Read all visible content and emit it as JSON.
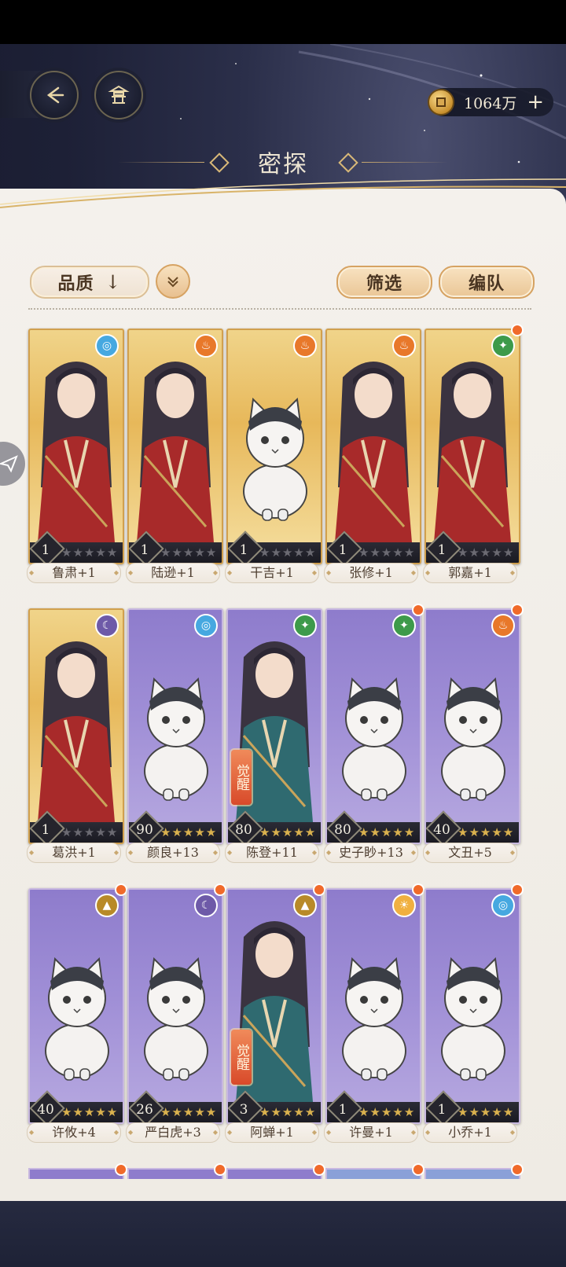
{
  "header": {
    "currency_amount": "1064万",
    "title": "密探"
  },
  "toolbar": {
    "sort_label": "品质",
    "sort_arrow": "↓",
    "filter_label": "筛选",
    "team_label": "编队"
  },
  "colors": {
    "accent_gold": "#d6a262",
    "card_gold": "#e7b85a",
    "card_purple": "#9f8ed6",
    "notify_dot": "#f06a2a"
  },
  "cards": [
    {
      "name": "鲁肃+1",
      "level": "1",
      "quality": "gold",
      "element": "water-icon",
      "stars_lit": 0,
      "red_dot": false,
      "awakened": false,
      "is_cat": false
    },
    {
      "name": "陆逊+1",
      "level": "1",
      "quality": "gold",
      "element": "fire-icon",
      "stars_lit": 0,
      "red_dot": false,
      "awakened": false,
      "is_cat": false
    },
    {
      "name": "干吉+1",
      "level": "1",
      "quality": "gold",
      "element": "fire-icon",
      "stars_lit": 0,
      "red_dot": false,
      "awakened": false,
      "is_cat": true
    },
    {
      "name": "张修+1",
      "level": "1",
      "quality": "gold",
      "element": "fire-icon",
      "stars_lit": 0,
      "red_dot": false,
      "awakened": false,
      "is_cat": false
    },
    {
      "name": "郭嘉+1",
      "level": "1",
      "quality": "gold",
      "element": "wood-icon",
      "stars_lit": 0,
      "red_dot": true,
      "awakened": false,
      "is_cat": false
    },
    {
      "name": "葛洪+1",
      "level": "1",
      "quality": "gold",
      "element": "moon-icon",
      "stars_lit": 0,
      "red_dot": false,
      "awakened": false,
      "is_cat": false
    },
    {
      "name": "颜良+13",
      "level": "90",
      "quality": "purple",
      "element": "water-icon",
      "stars_lit": 5,
      "red_dot": false,
      "awakened": false,
      "is_cat": true
    },
    {
      "name": "陈登+11",
      "level": "80",
      "quality": "purple",
      "element": "wood-icon",
      "stars_lit": 5,
      "red_dot": false,
      "awakened": true,
      "is_cat": false
    },
    {
      "name": "史子眇+13",
      "level": "80",
      "quality": "purple",
      "element": "wood-icon",
      "stars_lit": 5,
      "red_dot": true,
      "awakened": false,
      "is_cat": true
    },
    {
      "name": "文丑+5",
      "level": "40",
      "quality": "purple",
      "element": "fire-icon",
      "stars_lit": 5,
      "red_dot": true,
      "awakened": false,
      "is_cat": true
    },
    {
      "name": "许攸+4",
      "level": "40",
      "quality": "purple",
      "element": "earth-icon",
      "stars_lit": 5,
      "red_dot": true,
      "awakened": false,
      "is_cat": true
    },
    {
      "name": "严白虎+3",
      "level": "26",
      "quality": "purple",
      "element": "moon-icon",
      "stars_lit": 5,
      "red_dot": true,
      "awakened": false,
      "is_cat": true
    },
    {
      "name": "阿蝉+1",
      "level": "3",
      "quality": "purple",
      "element": "earth-icon",
      "stars_lit": 5,
      "red_dot": true,
      "awakened": true,
      "is_cat": false
    },
    {
      "name": "许曼+1",
      "level": "1",
      "quality": "purple",
      "element": "sun-icon",
      "stars_lit": 5,
      "red_dot": true,
      "awakened": false,
      "is_cat": true
    },
    {
      "name": "小乔+1",
      "level": "1",
      "quality": "purple",
      "element": "water-icon",
      "stars_lit": 5,
      "red_dot": true,
      "awakened": false,
      "is_cat": true
    }
  ],
  "awaken_label": "觉醒"
}
